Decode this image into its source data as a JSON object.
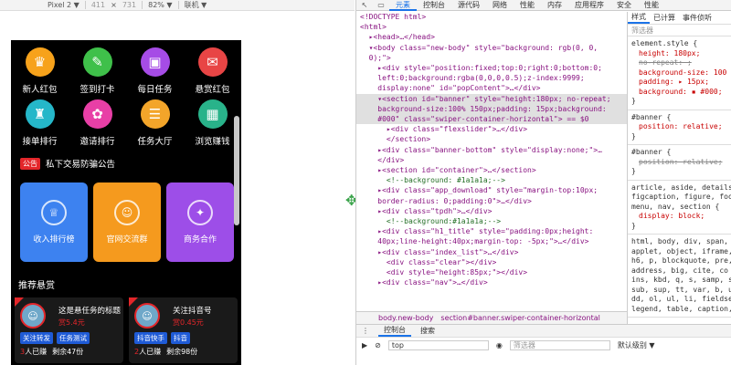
{
  "devbar": {
    "device": "Pixel 2 ▼",
    "width": "411",
    "height": "731",
    "zoom": "82% ▼",
    "network": "联机 ▼"
  },
  "app": {
    "icons_row1": [
      {
        "label": "新人红包",
        "color": "#f7a21b",
        "glyph": "♛"
      },
      {
        "label": "签到打卡",
        "color": "#3fc04a",
        "glyph": "✎"
      },
      {
        "label": "每日任务",
        "color": "#a64ce6",
        "glyph": "▣"
      },
      {
        "label": "悬赏红包",
        "color": "#e84545",
        "glyph": "✉"
      }
    ],
    "icons_row2": [
      {
        "label": "接单排行",
        "color": "#25b7c9",
        "glyph": "♜"
      },
      {
        "label": "邀请排行",
        "color": "#e83fa6",
        "glyph": "✿"
      },
      {
        "label": "任务大厅",
        "color": "#f3a52a",
        "glyph": "☰"
      },
      {
        "label": "浏览赚钱",
        "color": "#29b38a",
        "glyph": "▦"
      }
    ],
    "notice_badge": "公告",
    "notice_text": "私下交易防骗公告",
    "cards": [
      {
        "label": "收入排行榜",
        "color": "#3d82f0",
        "glyph": "♕"
      },
      {
        "label": "官网交流群",
        "color": "#f59a1e",
        "glyph": "☺"
      },
      {
        "label": "商务合作",
        "color": "#9d4ee8",
        "glyph": "✦"
      }
    ],
    "section_title": "推荐悬赏",
    "tasks": [
      {
        "title": "这是悬任务的标题",
        "price": "赏5.4元",
        "tags": [
          "关注转发",
          "任务测试"
        ],
        "done": "3",
        "done_label": "人已赚",
        "left": "剩余47份"
      },
      {
        "title": "关注抖音号",
        "price": "赏0.45元",
        "tags": [
          "抖音快手",
          "抖音"
        ],
        "done": "2",
        "done_label": "人已赚",
        "left": "剩余98份"
      }
    ]
  },
  "devtools": {
    "tabs": [
      "元素",
      "控制台",
      "源代码",
      "网络",
      "性能",
      "内存",
      "应用程序",
      "安全",
      "性能"
    ],
    "lines": [
      "<!DOCTYPE html>",
      "<html>",
      "  ▸<head>…</head>",
      "  ▾<body class=\"new-body\" style=\"background: rgb(0, 0,",
      "  0);\">",
      "    ▸<div style=\"position:fixed;top:0;right:0;bottom:0;",
      "    left:0;background:rgba(0,0,0,0.5);z-index:9999;",
      "    display:none\" id=\"popContent\">…</div>",
      "    ▾<section id=\"banner\" style=\"height:180px; no-repeat;",
      "    background-size:100% 150px;padding: 15px;background:",
      "    #000\" class=\"swiper-container-horizontal\"> == $0",
      "      ▸<div class=\"flexslider\">…</div>",
      "      </section>",
      "    ▸<div class=\"banner-bottom\" style=\"display:none;\">…",
      "    </div>",
      "    ▸<section id=\"container\">…</section>",
      "      <!--background: #1a1a1a;-->",
      "    ▸<div class=\"app_download\" style=\"margin-top:10px;",
      "    border-radius: 0;padding:0\">…</div>",
      "    ▸<div class=\"tpdh\">…</div>",
      "      <!--background:#1a1a1a;-->",
      "    ▸<div class=\"h1_title\" style=\"padding:0px;height:",
      "    40px;line-height:40px;margin-top: -5px;\">…</div>",
      "    ▸<div class=\"index_list\">…</div>",
      "      <div class=\"clear\"></div>",
      "      <div style=\"height:85px;\"></div>",
      "    ▸<div class=\"nav\">…</div>"
    ],
    "crumb1": "body.new-body",
    "crumb2": "section#banner.swiper-container-horizontal",
    "styles_tabs": [
      "样式",
      "已计算",
      "事件侦听"
    ],
    "filter": "筛选器",
    "style_block1": [
      "element.style {",
      "height: 180px;",
      "no-repeat: ;",
      "background-size: 100",
      "padding: ▸ 15px;",
      "background: ▪ #000;",
      "}"
    ],
    "style_block2": [
      "#banner {",
      "position: relative;",
      "}"
    ],
    "style_block3": [
      "#banner {",
      "position: relative;",
      "}"
    ],
    "style_block4": [
      "article, aside, details",
      "figcaption, figure, foo",
      "menu, nav, section {",
      "display: block;",
      "}"
    ],
    "style_block5": [
      "html, body, div, span,",
      "applet, object, iframe,",
      "h6, p, blockquote, pre,",
      "address, big, cite, co",
      "ins, kbd, q, s, samp, s",
      "sub, sup, tt, var, b, u",
      "dd, ol, ul, li, fieldse",
      "legend, table, caption,"
    ],
    "drawer_tabs": [
      "控制台",
      "搜索"
    ],
    "console_top": "top",
    "console_filter": "筛选器",
    "console_level": "默认级别 ▼"
  }
}
